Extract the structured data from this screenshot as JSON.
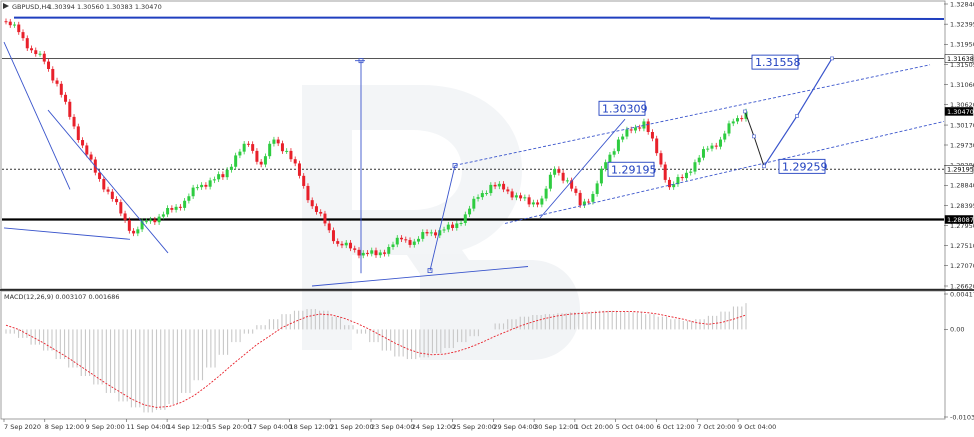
{
  "header": {
    "symbol_label": "GBPUSD,H4",
    "ohlc_label": "1.30394 1.30560 1.30383 1.30470"
  },
  "macd_panel": {
    "label": "MACD(12,26,9) 0.003107 0.001686",
    "y_ticks": [
      "0.004177",
      "0.00",
      "-0.010338"
    ]
  },
  "chart_data": [
    {
      "type": "candlestick",
      "title": "GBPUSD,H4",
      "ylim": [
        1.2662,
        1.3284
      ],
      "y_ticks": [
        "1.32840",
        "1.32395",
        "1.31950",
        "1.31505",
        "1.31060",
        "1.30620",
        "1.30170",
        "1.29730",
        "1.29280",
        "1.28840",
        "1.28395",
        "1.27950",
        "1.27510",
        "1.27070",
        "1.26620"
      ],
      "x_ticks": [
        "7 Sep 2020",
        "8 Sep 12:00",
        "9 Sep 20:00",
        "11 Sep 04:00",
        "14 Sep 12:00",
        "15 Sep 20:00",
        "17 Sep 04:00",
        "18 Sep 12:00",
        "21 Sep 20:00",
        "23 Sep 04:00",
        "24 Sep 12:00",
        "25 Sep 20:00",
        "29 Sep 04:00",
        "30 Sep 12:00",
        "1 Oct 20:00",
        "5 Oct 04:00",
        "6 Oct 12:00",
        "7 Oct 20:00",
        "9 Oct 04:00"
      ],
      "price_badges": [
        {
          "label": "1.31638",
          "value": 1.31638,
          "bg": "#ffffff"
        },
        {
          "label": "1.30470",
          "value": 1.3047,
          "bg": "#000000"
        },
        {
          "label": "1.29195",
          "value": 1.29195,
          "bg": "#ffffff"
        },
        {
          "label": "1.28087",
          "value": 1.28087,
          "bg": "#000000"
        }
      ],
      "horizontal_lines": [
        {
          "value": 1.31638,
          "style": "solid",
          "color": "#555555"
        },
        {
          "value": 1.29195,
          "style": "dotted",
          "color": "#333333"
        },
        {
          "value": 1.28087,
          "style": "solid",
          "color": "#000000"
        }
      ],
      "forecast_labels": [
        {
          "label": "1.31558",
          "value": 1.31558
        },
        {
          "label": "1.30309",
          "value": 1.30309
        },
        {
          "label": "1.29195",
          "value": 1.29195
        },
        {
          "label": "1.29259",
          "value": 1.29259
        }
      ],
      "forecast_path": [
        1.3047,
        1.2992,
        1.2926,
        1.3037,
        1.3164
      ],
      "close_path": [
        1.3245,
        1.3222,
        1.3182,
        1.3157,
        1.3108,
        1.3035,
        1.2972,
        1.2912,
        1.287,
        1.2822,
        1.2778,
        1.2805,
        1.2815,
        1.283,
        1.285,
        1.288,
        1.2895,
        1.2902,
        1.295,
        1.2975,
        1.293,
        1.2985,
        1.296,
        1.2905,
        1.2838,
        1.28,
        1.2755,
        1.2745,
        1.2735,
        1.273,
        1.2748,
        1.2765,
        1.276,
        1.2778,
        1.2785,
        1.279,
        1.282,
        1.2858,
        1.2885,
        1.2875,
        1.2862,
        1.2842,
        1.2855,
        1.292,
        1.2895,
        1.284,
        1.2865,
        1.2935,
        1.2985,
        1.3005,
        1.3025,
        1.2955,
        1.288,
        1.29,
        1.2935,
        1.2965,
        1.2985,
        1.3025,
        1.3047
      ]
    },
    {
      "type": "bar",
      "title": "MACD(12,26,9)",
      "ylim": [
        -0.010338,
        0.004177
      ],
      "macd_values": [
        -0.0005,
        -0.001,
        -0.0018,
        -0.0025,
        -0.0035,
        -0.0045,
        -0.0055,
        -0.0065,
        -0.0075,
        -0.0085,
        -0.0092,
        -0.0098,
        -0.0095,
        -0.0088,
        -0.0075,
        -0.006,
        -0.0045,
        -0.003,
        -0.0015,
        -0.0005,
        0.0005,
        0.0012,
        0.0018,
        0.0022,
        0.0024,
        0.0022,
        0.0015,
        0.0005,
        -0.0005,
        -0.0015,
        -0.0025,
        -0.0032,
        -0.0035,
        -0.0033,
        -0.0028,
        -0.0022,
        -0.0015,
        -0.0008,
        0.0,
        0.0007,
        0.0012,
        0.0015,
        0.0017,
        0.0018,
        0.0019,
        0.002,
        0.0021,
        0.0022,
        0.0022,
        0.0021,
        0.002,
        0.0018,
        0.0015,
        0.0012,
        0.001,
        0.0012,
        0.0016,
        0.0021,
        0.0027,
        0.0031
      ],
      "signal_values": [
        0.0005,
        0.0,
        -0.0008,
        -0.0016,
        -0.0025,
        -0.0034,
        -0.0044,
        -0.0054,
        -0.0064,
        -0.0073,
        -0.0082,
        -0.0089,
        -0.0092,
        -0.0091,
        -0.0086,
        -0.0078,
        -0.0067,
        -0.0055,
        -0.0042,
        -0.003,
        -0.0018,
        -0.0008,
        0.0002,
        0.0009,
        0.0015,
        0.0018,
        0.0017,
        0.0013,
        0.0007,
        0.0,
        -0.0008,
        -0.0016,
        -0.0023,
        -0.0028,
        -0.003,
        -0.0029,
        -0.0026,
        -0.0021,
        -0.0015,
        -0.0008,
        -0.0002,
        0.0004,
        0.0009,
        0.0013,
        0.0016,
        0.0018,
        0.0019,
        0.002,
        0.0021,
        0.0021,
        0.0021,
        0.002,
        0.0018,
        0.0015,
        0.0012,
        0.0008,
        0.0006,
        0.0008,
        0.0012,
        0.0017
      ]
    }
  ]
}
